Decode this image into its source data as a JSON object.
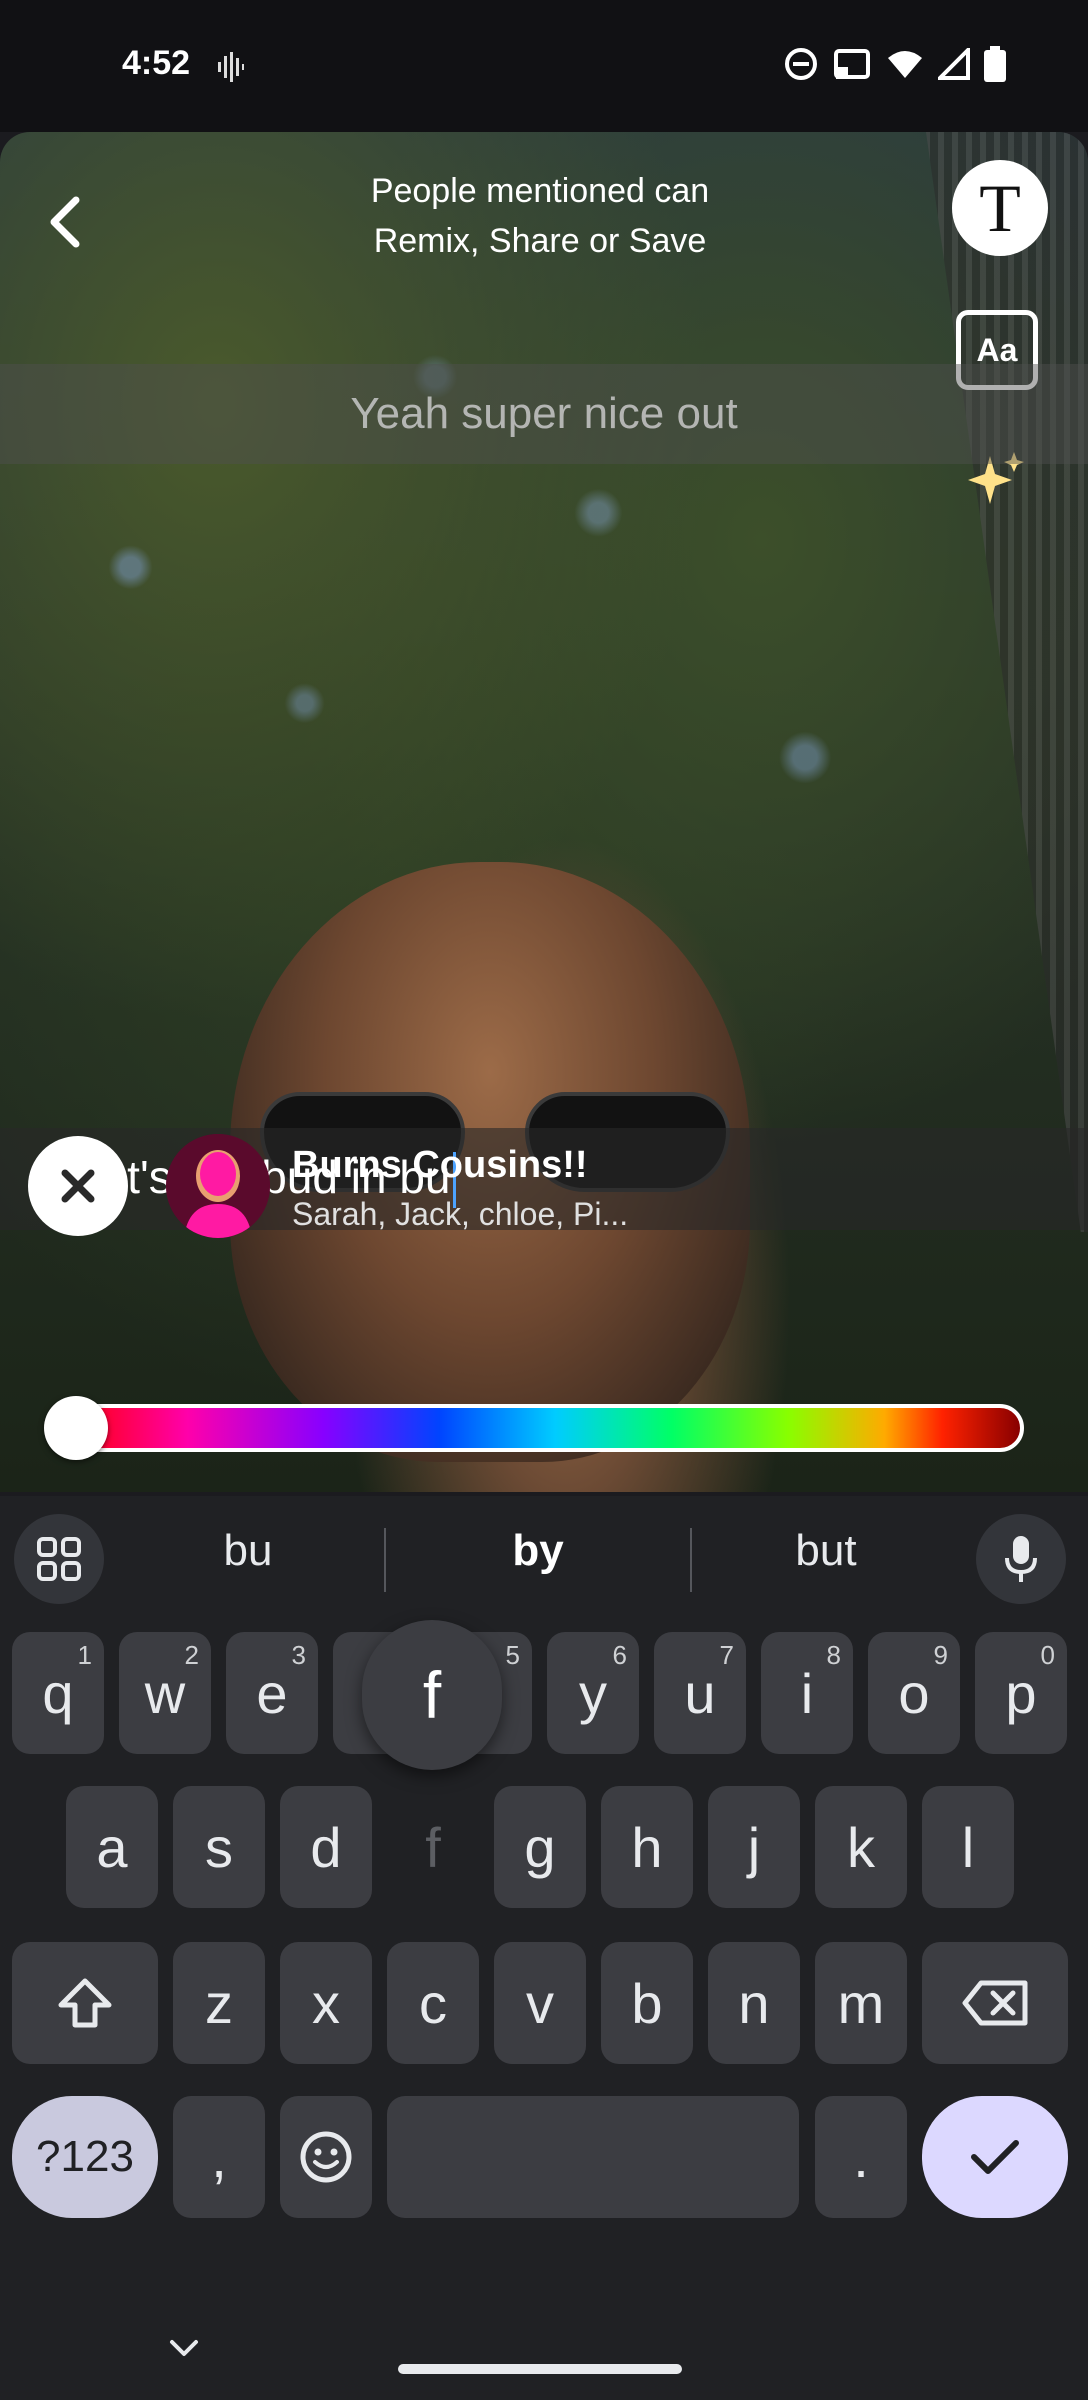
{
  "status_bar": {
    "time": "4:52",
    "icons": [
      "voice-activity-icon",
      "do-not-disturb-icon",
      "cast-icon",
      "wifi-icon",
      "signal-icon",
      "battery-icon"
    ]
  },
  "editor": {
    "banner_line1": "People mentioned can",
    "banner_line2": "Remix, Share or Save",
    "text_tool_label": "T",
    "font_tool_label": "Aa",
    "top_caption": "Yeah super nice out",
    "editing_caption": "Let's get bud in bu"
  },
  "mention": {
    "title": "Burns Cousins!!",
    "subtitle": "Sarah, Jack, chloe, Pi..."
  },
  "keyboard": {
    "suggestions": [
      "bu",
      "by",
      "but"
    ],
    "popup_key": "f",
    "row1": [
      {
        "k": "q",
        "n": "1"
      },
      {
        "k": "w",
        "n": "2"
      },
      {
        "k": "e",
        "n": "3"
      },
      {
        "k": "r",
        "n": "4"
      },
      {
        "k": "t",
        "n": "5"
      },
      {
        "k": "y",
        "n": "6"
      },
      {
        "k": "u",
        "n": "7"
      },
      {
        "k": "i",
        "n": "8"
      },
      {
        "k": "o",
        "n": "9"
      },
      {
        "k": "p",
        "n": "0"
      }
    ],
    "row2": [
      "a",
      "s",
      "d",
      "f",
      "g",
      "h",
      "j",
      "k",
      "l"
    ],
    "row3": [
      "z",
      "x",
      "c",
      "v",
      "b",
      "n",
      "m"
    ],
    "sym_label": "?123",
    "comma_label": ",",
    "period_label": "."
  },
  "colors": {
    "background": "#1b1b1f",
    "keyboard": "#202124",
    "key": "#3c3d42",
    "enter_key": "#dcd8ff",
    "caret": "#4da3ff"
  }
}
